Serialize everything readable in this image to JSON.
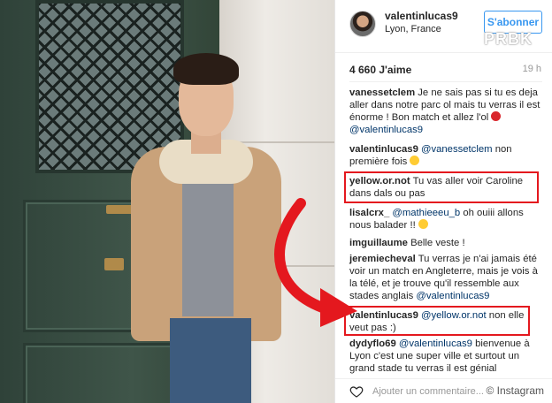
{
  "header": {
    "username": "valentinlucas9",
    "location": "Lyon, France",
    "follow_label": "S'abonner",
    "watermark_brand": "PRBK"
  },
  "post": {
    "likes": "4 660 J'aime",
    "time": "19 h"
  },
  "comments": [
    {
      "user": "vanessetclem",
      "text": "Je ne sais pas si tu es deja aller dans notre parc ol mais tu verras il est énorme ! Bon match et allez l'ol",
      "emoji": "red-circle",
      "mention": "@valentinlucas9"
    },
    {
      "user": "valentinlucas9",
      "mention": "@vanessetclem",
      "text": "non première fois",
      "emoji": "heart-eyes"
    },
    {
      "user": "yellow.or.not",
      "text": "Tu vas aller voir Caroline dans dals ou pas",
      "highlighted": true
    },
    {
      "user": "lisalcrx_",
      "mention": "@mathieeeu_b",
      "text": "oh ouiii allons nous balader !!",
      "emoji": "laughing"
    },
    {
      "user": "imguillaume",
      "text": "Belle veste !"
    },
    {
      "user": "jeremiecheval",
      "text": "Tu verras je n'ai jamais été voir un match en Angleterre, mais je vois à la télé, et je trouve qu'il ressemble aux stades anglais",
      "mention": "@valentinlucas9"
    },
    {
      "user": "valentinlucas9",
      "mention": "@yellow.or.not",
      "text": "non elle veut pas :)",
      "highlighted": true
    },
    {
      "user": "dydyflo69",
      "mention": "@valentinlucas9",
      "text": "bienvenue à Lyon c'est une super ville et surtout un grand stade tu verras il est génial"
    }
  ],
  "footer": {
    "add_comment_placeholder": "Ajouter un commentaire...",
    "source": "© Instagram"
  },
  "colors": {
    "accent": "#3897f0",
    "mention": "#003569",
    "highlight": "#e4181e"
  },
  "icons": [
    "heart-icon",
    "red-circle-emoji",
    "heart-eyes-emoji",
    "laughing-emoji",
    "curved-arrow-icon"
  ]
}
